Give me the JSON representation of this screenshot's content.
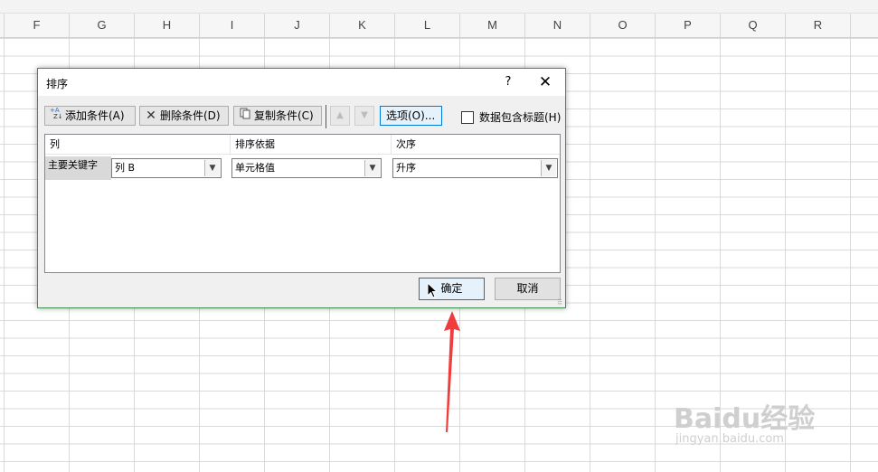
{
  "sheet": {
    "columns": [
      "F",
      "G",
      "H",
      "I",
      "J",
      "K",
      "L",
      "M",
      "N",
      "O",
      "P",
      "Q",
      "R"
    ]
  },
  "dialog": {
    "title": "排序",
    "help": "?",
    "close": "✕",
    "toolbar": {
      "add_label": "添加条件(A)",
      "delete_label": "删除条件(D)",
      "copy_label": "复制条件(C)",
      "move_up": "▲",
      "move_down": "▼",
      "options_label": "选项(O)...",
      "header_checkbox_label": "数据包含标题(H)",
      "header_checkbox_checked": false
    },
    "columns_header": {
      "column": "列",
      "sort_on": "排序依据",
      "order": "次序"
    },
    "rows": [
      {
        "label": "主要关键字",
        "column": "列 B",
        "sort_on": "单元格值",
        "order": "升序"
      }
    ],
    "ok_label": "确定",
    "cancel_label": "取消"
  },
  "watermark": {
    "brand": "Baidu经验",
    "url": "jingyan.baidu.com"
  },
  "colors": {
    "dialog_border": "#3e8e4f",
    "focus_blue": "#0078d7",
    "arrow_red": "#f03c3c"
  }
}
